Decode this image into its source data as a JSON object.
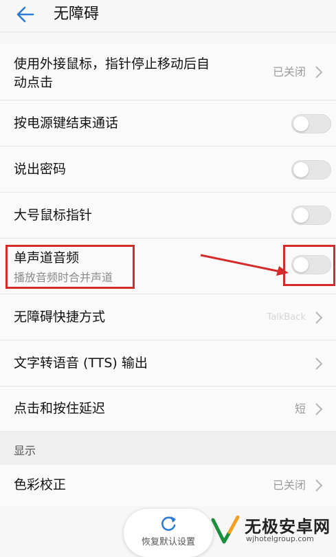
{
  "header": {
    "title": "无障碍",
    "back_icon": "arrow-left-icon"
  },
  "rows": [
    {
      "label_line1": "使用外接鼠标，指针停止移动后自",
      "label_line2": "动点击",
      "status": "已关闭"
    },
    {
      "label": "按电源键结束通话",
      "toggle_on": false
    },
    {
      "label": "说出密码",
      "toggle_on": false
    },
    {
      "label": "大号鼠标指针",
      "toggle_on": false
    },
    {
      "label": "单声道音频",
      "sub": "播放音频时合并声道",
      "toggle_on": false
    },
    {
      "label": "无障碍快捷方式",
      "status": "TalkBack"
    },
    {
      "label": "文字转语音 (TTS) 输出"
    },
    {
      "label": "点击和按住延迟",
      "status": "短"
    }
  ],
  "section": {
    "label": "显示"
  },
  "display_rows": [
    {
      "label": "色彩校正",
      "status": "已关闭"
    }
  ],
  "reset": {
    "label": "恢复默认设置",
    "icon": "refresh-icon"
  },
  "watermark": {
    "name": "无极安卓网",
    "url": "wjhotelgroup.com"
  },
  "colors": {
    "accent": "#2b7bd6",
    "highlight": "#d42a2a"
  }
}
